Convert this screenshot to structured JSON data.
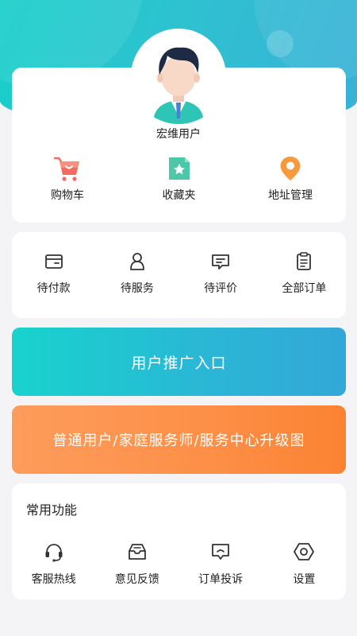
{
  "user": {
    "name": "宏维用户"
  },
  "quick_links": [
    {
      "label": "购物车",
      "icon": "shopping-cart-icon"
    },
    {
      "label": "收藏夹",
      "icon": "favorites-icon"
    },
    {
      "label": "地址管理",
      "icon": "location-pin-icon"
    }
  ],
  "orders": [
    {
      "label": "待付款",
      "icon": "wallet-icon"
    },
    {
      "label": "待服务",
      "icon": "person-icon"
    },
    {
      "label": "待评价",
      "icon": "comment-icon"
    },
    {
      "label": "全部订单",
      "icon": "clipboard-icon"
    }
  ],
  "banners": {
    "promo": "用户推广入口",
    "upgrade": "普通用户/家庭服务师/服务中心升级图"
  },
  "functions": {
    "title": "常用功能",
    "items": [
      {
        "label": "客服热线",
        "icon": "headset-icon"
      },
      {
        "label": "意见反馈",
        "icon": "feedback-inbox-icon"
      },
      {
        "label": "订单投诉",
        "icon": "complaint-icon"
      },
      {
        "label": "设置",
        "icon": "settings-hex-icon"
      }
    ]
  },
  "colors": {
    "header_teal": "#16cfc9",
    "promo_gradient": [
      "#18d3cd",
      "#33a7d8"
    ],
    "upgrade_gradient": [
      "#fd9c5c",
      "#fc8232"
    ],
    "cart_red": "#f36a5f",
    "favorites_green": "#4cc8a8",
    "pin_orange": "#f79a3e"
  }
}
